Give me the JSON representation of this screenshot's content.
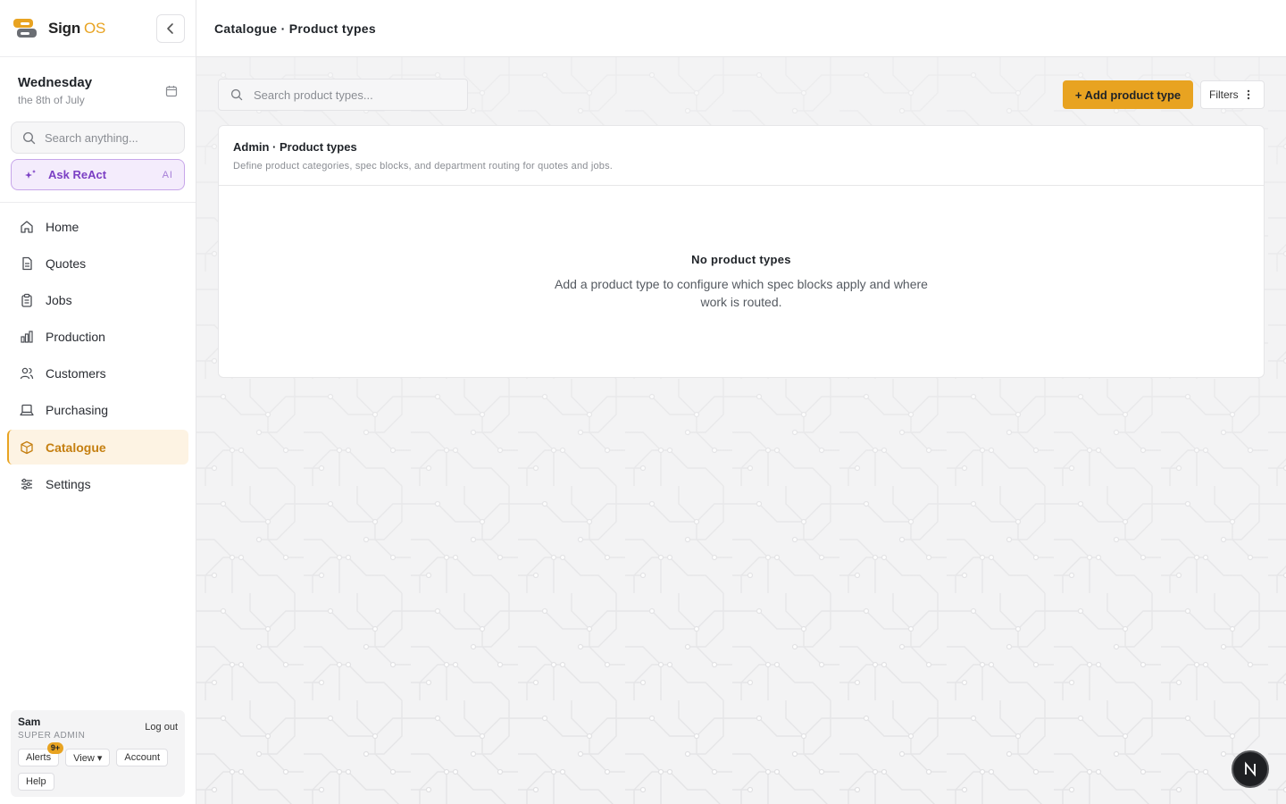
{
  "app": {
    "brand_name": "Sign",
    "brand_suffix": "OS",
    "accent_color": "#e8a321"
  },
  "sidebar": {
    "date_day": "Wednesday",
    "date_sub": "the 8th of July",
    "search_placeholder": "Search anything...",
    "ask_label": "Ask ReAct",
    "ask_tag": "AI",
    "items": [
      {
        "label": "Home",
        "icon": "home-icon"
      },
      {
        "label": "Quotes",
        "icon": "document-icon"
      },
      {
        "label": "Jobs",
        "icon": "clipboard-icon"
      },
      {
        "label": "Production",
        "icon": "bar-chart-icon"
      },
      {
        "label": "Customers",
        "icon": "users-icon"
      },
      {
        "label": "Purchasing",
        "icon": "laptop-icon"
      },
      {
        "label": "Catalogue",
        "icon": "box-icon",
        "active": true
      },
      {
        "label": "Settings",
        "icon": "sliders-icon"
      }
    ],
    "user": {
      "name": "Sam",
      "role": "SUPER ADMIN",
      "logout": "Log out",
      "alerts": "Alerts",
      "alerts_badge": "9+",
      "view": "View ▾",
      "account": "Account",
      "help": "Help"
    }
  },
  "topbar": {
    "breadcrumb": "Catalogue · Product types"
  },
  "main": {
    "search_placeholder": "Search product types...",
    "add_button": "+ Add product type",
    "filters_button": "Filters",
    "panel_title": "Admin · Product types",
    "panel_desc": "Define product categories, spec blocks, and department routing for quotes and jobs.",
    "empty_title": "No product types",
    "empty_text": "Add a product type to configure which spec blocks apply and where work is routed."
  }
}
